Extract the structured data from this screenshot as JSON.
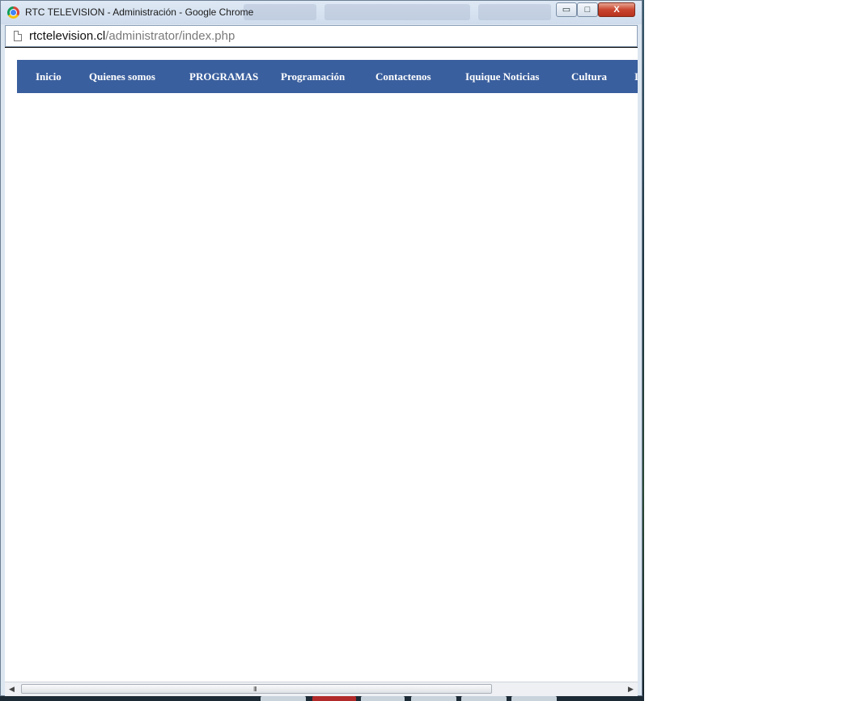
{
  "window": {
    "title": "RTC TELEVISION - Administración - Google Chrome",
    "controls": {
      "minimize": "▭",
      "maximize": "□",
      "close": "X"
    }
  },
  "address_bar": {
    "host": "rtctelevision.cl",
    "path": "/administrator/index.php"
  },
  "navbar": {
    "background": "#3a5f9e",
    "items": [
      {
        "label": "Inicio"
      },
      {
        "label": "Quienes somos"
      },
      {
        "label": "PROGRAMAS"
      },
      {
        "label": "Programación"
      },
      {
        "label": "Contactenos"
      },
      {
        "label": "Iquique Noticias"
      },
      {
        "label": "Cultura"
      },
      {
        "label": "I"
      }
    ]
  },
  "scrollbar": {
    "left_arrow": "◀",
    "right_arrow": "▶",
    "grip": "III"
  }
}
